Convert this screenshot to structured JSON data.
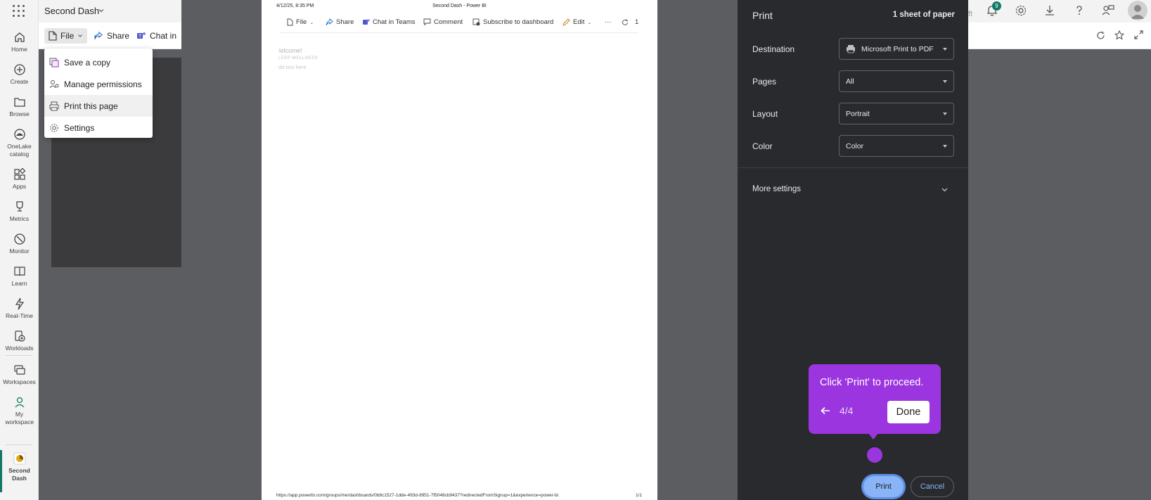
{
  "app": {
    "title": "Second Dash"
  },
  "nav": {
    "items": [
      {
        "label": "Home",
        "icon": "home-icon"
      },
      {
        "label": "Create",
        "icon": "create-icon"
      },
      {
        "label": "Browse",
        "icon": "browse-icon"
      },
      {
        "label": "OneLake catalog",
        "icon": "onelake-icon"
      },
      {
        "label": "Apps",
        "icon": "apps-icon"
      },
      {
        "label": "Metrics",
        "icon": "metrics-icon"
      },
      {
        "label": "Monitor",
        "icon": "monitor-icon"
      },
      {
        "label": "Learn",
        "icon": "learn-icon"
      },
      {
        "label": "Real-Time",
        "icon": "realtime-icon"
      },
      {
        "label": "Workloads",
        "icon": "workloads-icon"
      },
      {
        "label": "Workspaces",
        "icon": "workspaces-icon"
      },
      {
        "label": "My workspace",
        "icon": "my-workspace-icon"
      },
      {
        "label": "Second Dash",
        "icon": "dashboard-icon"
      }
    ]
  },
  "toolbar": {
    "file": "File",
    "share": "Share",
    "chat": "Chat in"
  },
  "file_menu": {
    "items": [
      {
        "label": "Save a copy",
        "icon": "save-copy-icon"
      },
      {
        "label": "Manage permissions",
        "icon": "permissions-icon"
      },
      {
        "label": "Print this page",
        "icon": "print-icon"
      },
      {
        "label": "Settings",
        "icon": "settings-icon"
      }
    ]
  },
  "preview": {
    "date": "4/12/25, 8:35 PM",
    "title": "Second Dash - Power BI",
    "commands": {
      "file": "File",
      "share": "Share",
      "chat": "Chat in Teams",
      "comment": "Comment",
      "subscribe": "Subscribe to dashboard",
      "edit": "Edit",
      "more": "···",
      "extra": "1"
    },
    "welcome": "/elcome!",
    "welcome_sub": "LEEP WELLNESS",
    "welcome_hint": "dd text here",
    "footer_url": "https://app.powerbi.com/groups/me/dashboards/0b8c1527-1dde-493d-8951-7f5048cb9437?redirectedFromSignup=1&experience=power-bi",
    "footer_page": "1/1"
  },
  "print_dialog": {
    "title": "Print",
    "sheets": "1 sheet of paper",
    "destination_label": "Destination",
    "destination_value": "Microsoft Print to PDF",
    "pages_label": "Pages",
    "pages_value": "All",
    "layout_label": "Layout",
    "layout_value": "Portrait",
    "color_label": "Color",
    "color_value": "Color",
    "more_settings": "More settings",
    "print_button": "Print",
    "cancel_button": "Cancel"
  },
  "guide": {
    "message": "Click 'Print' to proceed.",
    "step": "4/4",
    "done": "Done"
  },
  "browser": {
    "partial_text": "ft",
    "notification_count": "9"
  },
  "colors": {
    "accent": "#117865",
    "guide_purple": "#9b35e0",
    "print_blue": "#8ab4f8",
    "dialog_bg": "#292a2d"
  }
}
